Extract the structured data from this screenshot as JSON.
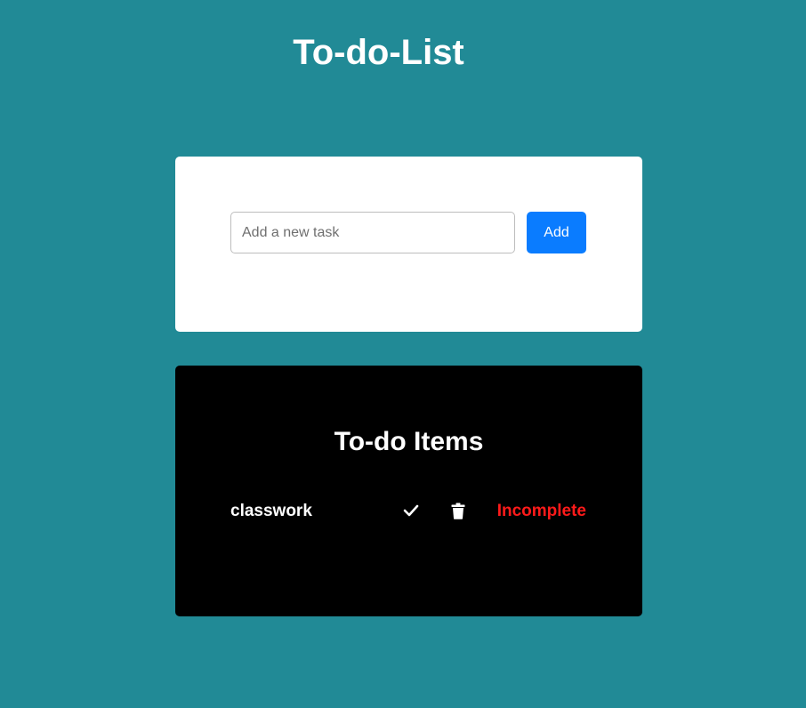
{
  "header": {
    "title": "To-do-List"
  },
  "add_form": {
    "input_value": "",
    "input_placeholder": "Add a new task",
    "add_button_label": "Add",
    "add_button_color": "#0a7cff"
  },
  "todo_list": {
    "heading": "To-do Items",
    "items": [
      {
        "text": "classwork",
        "complete_icon": "check-icon",
        "delete_icon": "trash-icon",
        "status": "Incomplete",
        "status_color": "#ff1a1a"
      }
    ]
  },
  "colors": {
    "page_background": "#218a96",
    "input_card_background": "#ffffff",
    "list_card_background": "#000000"
  }
}
